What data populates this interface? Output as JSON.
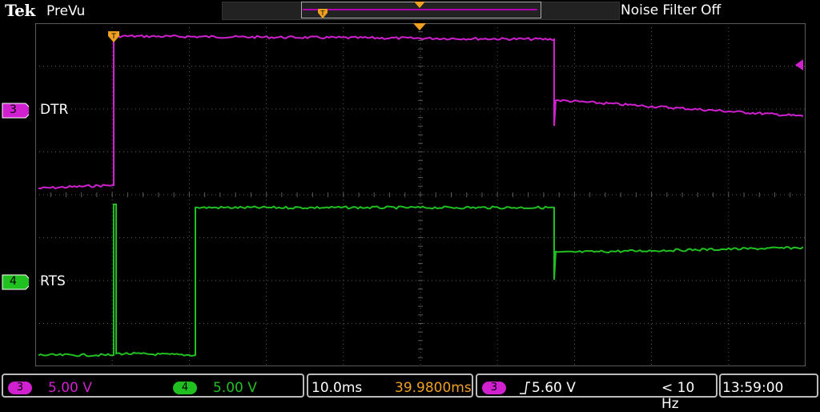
{
  "header": {
    "brand": "Tek",
    "mode": "PreVu",
    "noise_filter": "Noise Filter Off"
  },
  "channels": [
    {
      "id": "3",
      "label": "DTR",
      "color": "#d020d0"
    },
    {
      "id": "4",
      "label": "RTS",
      "color": "#20c020"
    }
  ],
  "status": {
    "ch3_num": "3",
    "ch3_scale": "5.00 V",
    "ch4_num": "4",
    "ch4_scale": "5.00 V",
    "timebase": "10.0ms",
    "trigger_pos": "39.9800ms",
    "trig_src": "3",
    "trig_level": "5.60 V",
    "trig_freq": "< 10 Hz",
    "clock": "13:59:00"
  },
  "colors": {
    "grid": "#5a5a5a",
    "trigger": "#f0a020",
    "ch3": "#d020d0",
    "ch4": "#20c020"
  }
}
